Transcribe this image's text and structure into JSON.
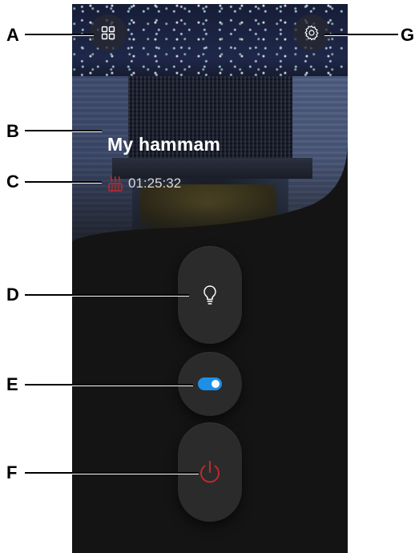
{
  "app": {
    "title": "My hammam",
    "timer": "01:25:32"
  },
  "icons": {
    "menu": "grid-icon",
    "settings": "gear-icon",
    "heater": "heater-icon",
    "light": "lightbulb-icon",
    "toggle": "toggle-switch-icon",
    "power": "power-icon"
  },
  "colors": {
    "background": "#141414",
    "pill": "#2b2b2b",
    "toggle_on": "#1e8fe6",
    "power": "#c0282d",
    "heater": "#c0282d"
  },
  "controls": {
    "toggle_state": "on"
  },
  "callouts": {
    "a": "A",
    "b": "B",
    "c": "C",
    "d": "D",
    "e": "E",
    "f": "F",
    "g": "G"
  }
}
